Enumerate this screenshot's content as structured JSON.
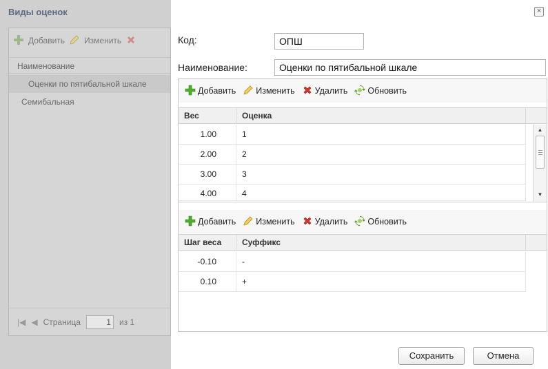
{
  "background_window": {
    "title": "Виды оценок",
    "toolbar": {
      "add_label": "Добавить",
      "edit_label": "Изменить"
    },
    "column_header": "Наименование",
    "rows": [
      "Оценки по пятибальной шкале",
      "Семибальная"
    ],
    "pager": {
      "page_label": "Страница",
      "page_value": "1",
      "of_label": "из 1"
    }
  },
  "dialog": {
    "close_glyph": "×",
    "code_label": "Код:",
    "code_value": "ОПШ",
    "name_label": "Наименование:",
    "name_value": "Оценки по пятибальной шкале",
    "grades_toolbar": {
      "add": "Добавить",
      "edit": "Изменить",
      "delete": "Удалить",
      "refresh": "Обновить"
    },
    "grades_table": {
      "headers": [
        "Вес",
        "Оценка"
      ],
      "rows": [
        {
          "weight": "1.00",
          "grade": "1"
        },
        {
          "weight": "2.00",
          "grade": "2"
        },
        {
          "weight": "3.00",
          "grade": "3"
        },
        {
          "weight": "4.00",
          "grade": "4"
        }
      ]
    },
    "suffix_toolbar": {
      "add": "Добавить",
      "edit": "Изменить",
      "delete": "Удалить",
      "refresh": "Обновить"
    },
    "suffix_table": {
      "headers": [
        "Шаг веса",
        "Суффикс"
      ],
      "rows": [
        {
          "step": "-0.10",
          "suffix": "-"
        },
        {
          "step": "0.10",
          "suffix": "+"
        }
      ]
    },
    "save_label": "Сохранить",
    "cancel_label": "Отмена"
  },
  "icons": {
    "add": "add-plus-icon",
    "edit": "pencil-icon",
    "delete": "red-x-icon",
    "refresh": "green-refresh-icon"
  },
  "colors": {
    "add_green": "#4caf2a",
    "delete_red": "#d9332a",
    "pencil_yellow": "#e8b93a",
    "title_blue": "#5a6a80"
  }
}
